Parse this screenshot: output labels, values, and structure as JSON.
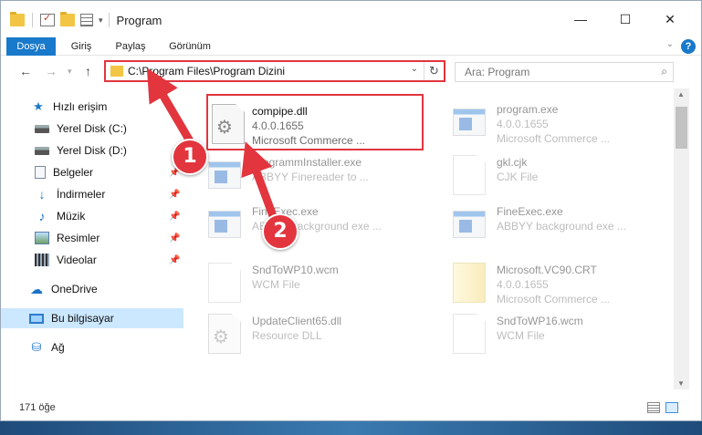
{
  "window": {
    "title": "Program"
  },
  "ribbon": {
    "tabs": [
      "Dosya",
      "Giriş",
      "Paylaş",
      "Görünüm"
    ],
    "help": "?"
  },
  "address": {
    "path": "C:\\Program Files\\Program Dizini"
  },
  "search": {
    "placeholder": "Ara: Program"
  },
  "sidebar": {
    "items": [
      {
        "label": "Hızlı erişim",
        "icon": "star-icon"
      },
      {
        "label": "Yerel Disk (C:)",
        "icon": "disk-icon"
      },
      {
        "label": "Yerel Disk (D:)",
        "icon": "disk-icon"
      },
      {
        "label": "Belgeler",
        "icon": "documents-icon"
      },
      {
        "label": "İndirmeler",
        "icon": "download-icon"
      },
      {
        "label": "Müzik",
        "icon": "music-icon"
      },
      {
        "label": "Resimler",
        "icon": "pictures-icon"
      },
      {
        "label": "Videolar",
        "icon": "video-icon"
      },
      {
        "label": "OneDrive",
        "icon": "cloud-icon"
      },
      {
        "label": "Bu bilgisayar",
        "icon": "computer-icon"
      },
      {
        "label": "Ağ",
        "icon": "network-icon"
      }
    ]
  },
  "files": [
    {
      "name": "compipe.dll",
      "line2": "4.0.0.1655",
      "line3": "Microsoft Commerce ...",
      "icon": "gear-file-icon"
    },
    {
      "name": "program.exe",
      "line2": "4.0.0.1655",
      "line3": "Microsoft Commerce ...",
      "icon": "exe-icon"
    },
    {
      "name": "ProgrammInstaller.exe",
      "line2": "ABBYY Finereader to ...",
      "line3": "",
      "icon": "exe-icon"
    },
    {
      "name": "gkl.cjk",
      "line2": "CJK File",
      "line3": "",
      "icon": "blank-file-icon"
    },
    {
      "name": "FineExec.exe",
      "line2": "ABBYY background exe ...",
      "line3": "",
      "icon": "exe-icon"
    },
    {
      "name": "FineExec.exe",
      "line2": "ABBYY background exe ...",
      "line3": "",
      "icon": "exe-icon"
    },
    {
      "name": "SndToWP10.wcm",
      "line2": "WCM File",
      "line3": "",
      "icon": "blank-file-icon"
    },
    {
      "name": "Microsoft.VC90.CRT",
      "line2": "4.0.0.1655",
      "line3": "Microsoft Commerce ...",
      "icon": "zip-file-icon"
    },
    {
      "name": "UpdateClient65.dll",
      "line2": "Resource DLL",
      "line3": "",
      "icon": "gear-file-icon"
    },
    {
      "name": "SndToWP16.wcm",
      "line2": "WCM File",
      "line3": "",
      "icon": "blank-file-icon"
    }
  ],
  "status": {
    "item_count": "171 öğe"
  },
  "annotations": {
    "badge1": "1",
    "badge2": "2",
    "color": "#e2353e"
  }
}
